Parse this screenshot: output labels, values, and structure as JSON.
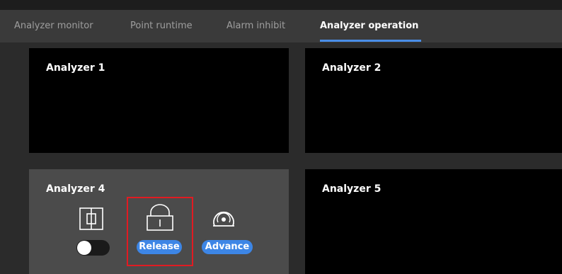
{
  "tabs": [
    {
      "label": "Analyzer monitor"
    },
    {
      "label": "Point runtime"
    },
    {
      "label": "Alarm inhibit"
    },
    {
      "label": "Analyzer operation"
    }
  ],
  "active_tab": "Analyzer operation",
  "panels": {
    "a1": {
      "title": "Analyzer 1"
    },
    "a2": {
      "title": "Analyzer 2"
    },
    "a4": {
      "title": "Analyzer 4"
    },
    "a5": {
      "title": "Analyzer 5"
    }
  },
  "actions": {
    "toggle_state": "off",
    "release_label": "Release",
    "advance_label": "Advance"
  },
  "icons": {
    "stream": "stream-switch-icon",
    "lock": "unlock-icon",
    "advance": "gauge-icon"
  },
  "colors": {
    "accent": "#3d86e6",
    "highlight": "#e11b22",
    "panel_selected": "#4b4b4b"
  }
}
